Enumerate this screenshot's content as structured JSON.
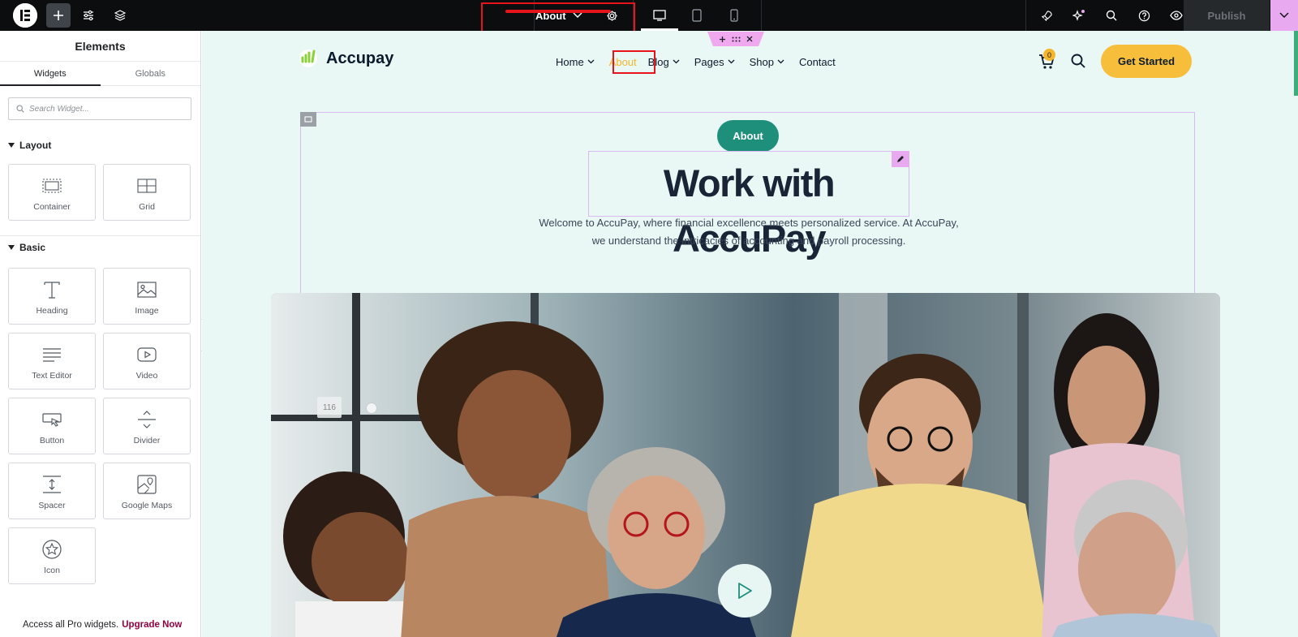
{
  "topbar": {
    "document_title": "About",
    "publish_label": "Publish"
  },
  "panel": {
    "title": "Elements",
    "tabs": [
      "Widgets",
      "Globals"
    ],
    "search_placeholder": "Search Widget...",
    "categories": {
      "layout": {
        "label": "Layout",
        "widgets": [
          "Container",
          "Grid"
        ]
      },
      "basic": {
        "label": "Basic",
        "widgets": [
          "Heading",
          "Image",
          "Text Editor",
          "Video",
          "Button",
          "Divider",
          "Spacer",
          "Google Maps",
          "Icon"
        ]
      }
    },
    "footer": {
      "text": "Access all Pro widgets.",
      "link": "Upgrade Now"
    }
  },
  "site": {
    "logo_text": "Accupay",
    "nav": [
      "Home",
      "About",
      "Blog",
      "Pages",
      "Shop",
      "Contact"
    ],
    "nav_active": "About",
    "cart_count": "0",
    "cta": "Get Started"
  },
  "hero": {
    "pill": "About",
    "heading": "Work with AccuPay",
    "subtitle_line1": "Welcome to AccuPay, where financial excellence meets personalized service. At AccuPay,",
    "subtitle_line2": "we understand the intricacies of accounting and payroll processing.",
    "spacer_value": "116"
  },
  "colors": {
    "accent": "#f6b62b",
    "teal": "#1d8f7b",
    "canvas_bg": "#e9f8f4",
    "highlight": "#e8141b"
  }
}
